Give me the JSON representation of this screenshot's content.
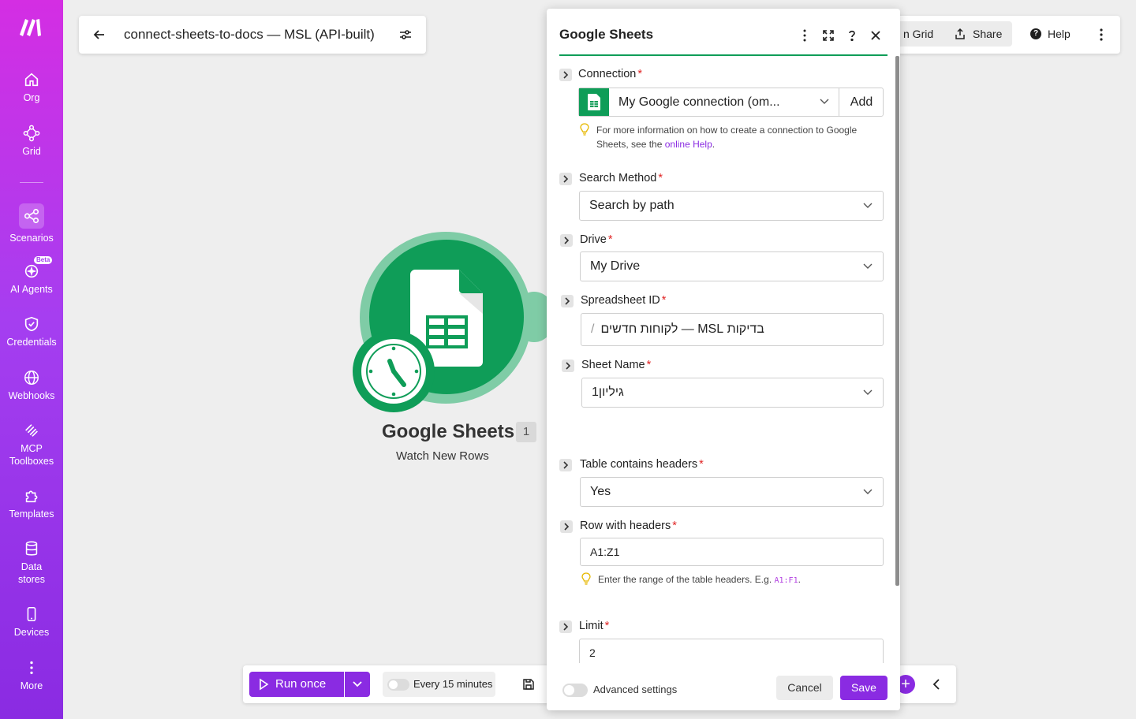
{
  "sidebar": {
    "items": [
      {
        "label": "Org",
        "icon": "home-icon"
      },
      {
        "label": "Grid",
        "icon": "grid-nodes-icon"
      },
      {
        "label": "Scenarios",
        "icon": "share-nodes-icon"
      },
      {
        "label": "AI Agents",
        "icon": "ai-agent-icon",
        "badge": "Beta"
      },
      {
        "label": "Credentials",
        "icon": "shield-icon"
      },
      {
        "label": "Webhooks",
        "icon": "globe-icon"
      },
      {
        "label": "MCP Toolboxes",
        "icon": "mcp-icon"
      },
      {
        "label": "Templates",
        "icon": "puzzle-icon"
      },
      {
        "label": "Data stores",
        "icon": "database-icon"
      },
      {
        "label": "Devices",
        "icon": "phone-icon"
      },
      {
        "label": "More",
        "icon": "dots-vertical-icon"
      }
    ],
    "active": "Scenarios"
  },
  "header": {
    "scenario_title": "connect-sheets-to-docs — MSL (API-built)",
    "grid_label": "n Grid",
    "share_label": "Share",
    "help_label": "Help"
  },
  "module": {
    "name": "Google Sheets",
    "badge": "1",
    "subtitle": "Watch New Rows"
  },
  "toolbar": {
    "run_label": "Run once",
    "schedule_label": "Every 15 minutes"
  },
  "panel": {
    "title": "Google Sheets",
    "fields": {
      "connection": {
        "label": "Connection",
        "value": "My Google connection (om...",
        "add": "Add",
        "hint_pre": "For more information on how to create a connection to Google Sheets, see the ",
        "hint_link": "online Help",
        "hint_post": "."
      },
      "search_method": {
        "label": "Search Method",
        "value": "Search by path"
      },
      "drive": {
        "label": "Drive",
        "value": "My Drive"
      },
      "spreadsheet_id": {
        "label": "Spreadsheet ID",
        "path_icon": "/",
        "value": "בדיקות MSL — לקוחות חדשים"
      },
      "sheet_name": {
        "label": "Sheet Name",
        "value": "גיליון1"
      },
      "table_headers": {
        "label": "Table contains headers",
        "value": "Yes"
      },
      "row_headers": {
        "label": "Row with headers",
        "value": "A1:Z1",
        "hint": "Enter the range of the table headers. E.g. ",
        "hint_code": "A1:F1",
        "hint_post": "."
      },
      "limit": {
        "label": "Limit",
        "value": "2"
      }
    },
    "required_mark": "*",
    "advanced_label": "Advanced settings",
    "cancel_label": "Cancel",
    "save_label": "Save"
  },
  "colors": {
    "brand_purple": "#8a2be2",
    "sheets_green": "#0f9d58",
    "required_red": "#e02424"
  }
}
